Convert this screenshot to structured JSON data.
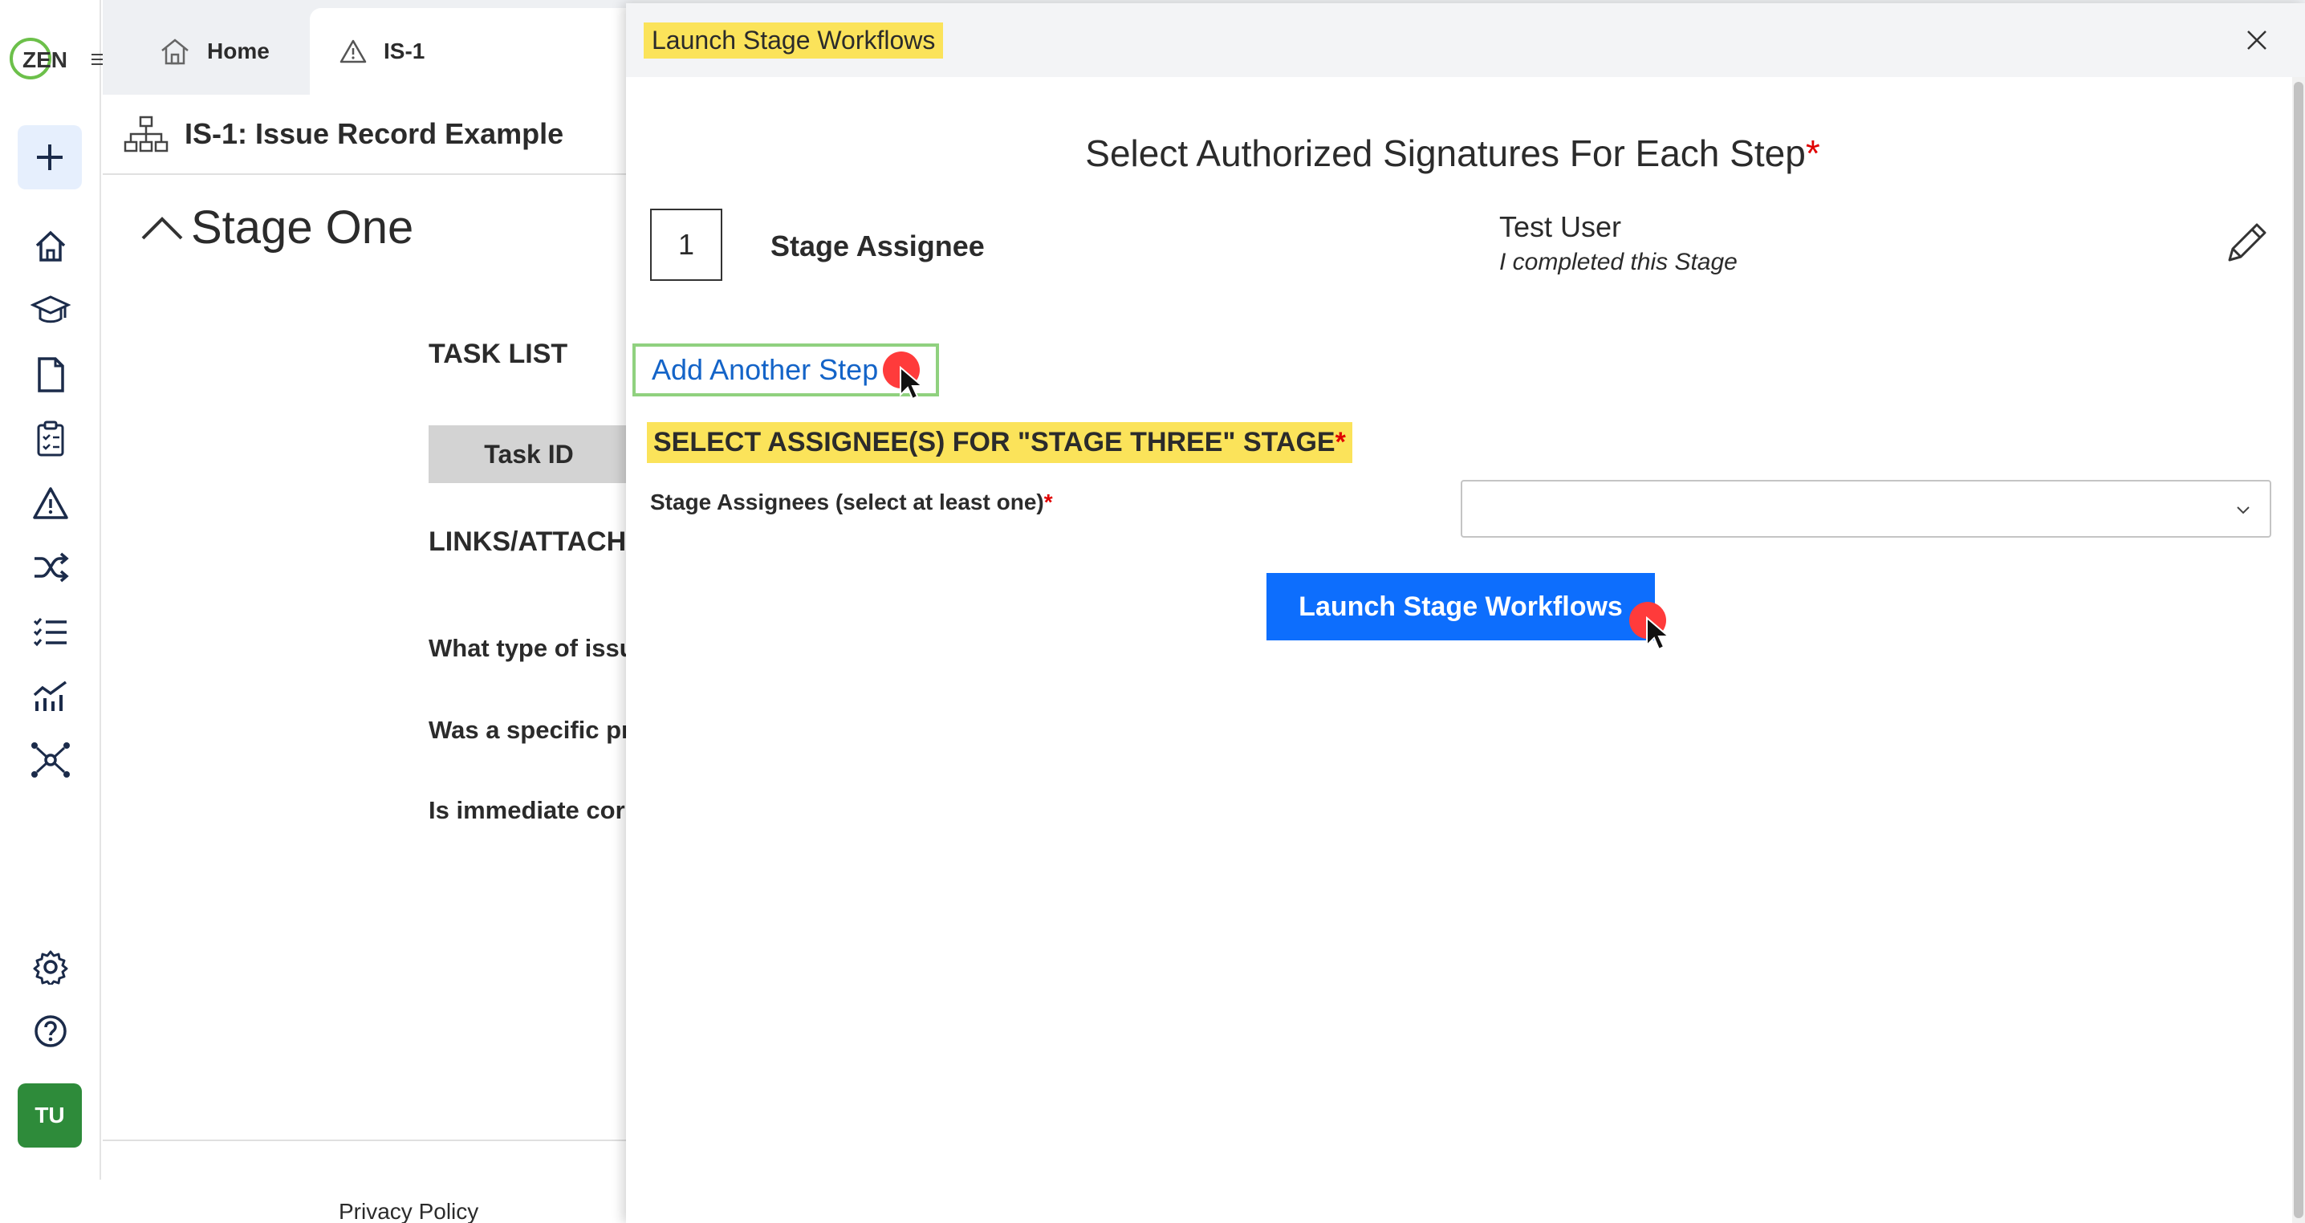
{
  "brand": {
    "logo_text": "ZEN",
    "accent": "#2e8b3a"
  },
  "rail": {
    "avatar_initials": "TU",
    "icons": [
      "plus-icon",
      "home-icon",
      "graduation-cap-icon",
      "document-icon",
      "clipboard-checklist-icon",
      "warning-icon",
      "shuffle-icon",
      "checklist-icon",
      "analytics-chart-icon",
      "network-hub-icon",
      "gear-icon",
      "help-icon"
    ]
  },
  "tabs": {
    "home_label": "Home",
    "active_label": "IS-1",
    "close_glyph": "×"
  },
  "record": {
    "title": "IS-1: Issue Record Example",
    "stage_title": "Stage One",
    "task_list": "TASK LIST",
    "task_id_header": "Task ID",
    "links_heading": "LINKS/ATTACH",
    "q1": "What type of issu",
    "q2": "Was a specific pr",
    "q3": "Is immediate cor",
    "privacy": "Privacy Policy"
  },
  "panel": {
    "title": "Launch Stage Workflows",
    "signatures_title": "Select Authorized Signatures For Each Step",
    "required_mark": "*",
    "step": {
      "number": "1",
      "role": "Stage Assignee",
      "user": "Test User",
      "note": "I completed this Stage"
    },
    "add_step_label": "Add Another Step",
    "assignee_heading": "SELECT ASSIGNEE(S) FOR \"STAGE THREE\" STAGE",
    "assignee_field_label": "Stage Assignees (select at least one)",
    "assignee_value": "",
    "launch_button": "Launch Stage Workflows",
    "colors": {
      "highlight": "#fbe35a",
      "primary": "#0d6efd",
      "link": "#1464c8",
      "required": "#e00000"
    }
  }
}
